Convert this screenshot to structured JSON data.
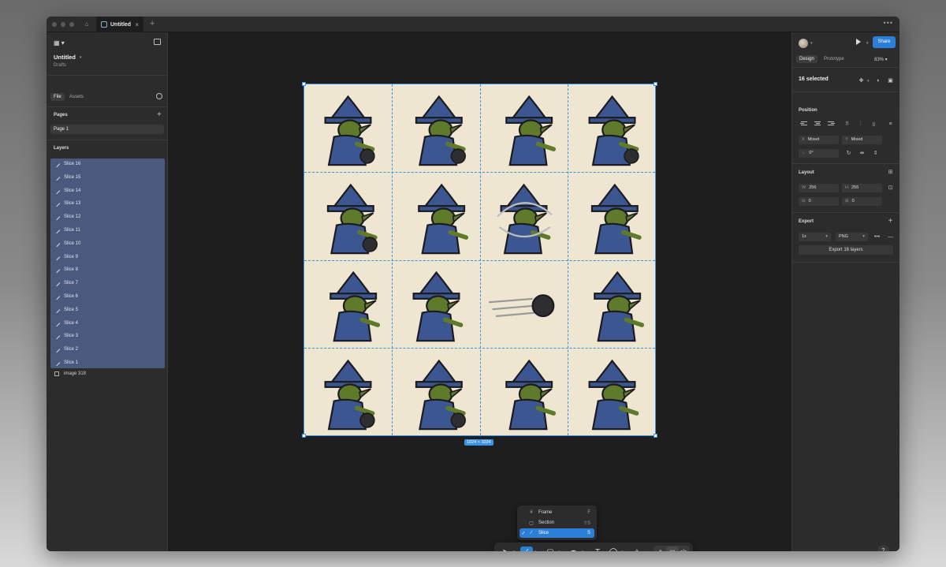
{
  "tabs": {
    "active_label": "Untitled",
    "close_glyph": "×",
    "new_glyph": "+",
    "more_glyph": "•••"
  },
  "left": {
    "file_title": "Untitled",
    "file_subtitle": "Drafts",
    "tab_file": "File",
    "tab_assets": "Assets",
    "pages_heading": "Pages",
    "add_glyph": "+",
    "pages": [
      {
        "label": "Page 1"
      }
    ],
    "layers_heading": "Layers",
    "layers": [
      {
        "label": "Slice 16"
      },
      {
        "label": "Slice 15"
      },
      {
        "label": "Slice 14"
      },
      {
        "label": "Slice 13"
      },
      {
        "label": "Slice 12"
      },
      {
        "label": "Slice 11"
      },
      {
        "label": "Slice 10"
      },
      {
        "label": "Slice 9"
      },
      {
        "label": "Slice 8"
      },
      {
        "label": "Slice 7"
      },
      {
        "label": "Slice 6"
      },
      {
        "label": "Slice 5"
      },
      {
        "label": "Slice 4"
      },
      {
        "label": "Slice 3"
      },
      {
        "label": "Slice 2"
      },
      {
        "label": "Slice 1"
      }
    ],
    "image_layer": "image 318"
  },
  "canvas": {
    "size_badge": "1024 × 1024",
    "colors": {
      "selection": "#3b93e6",
      "paper": "#efe6d2",
      "robe": "#3b5690",
      "skin": "#5f7a2a",
      "ink": "#1c1c20"
    }
  },
  "tool_menu": {
    "items": [
      {
        "label": "Frame",
        "shortcut": "F",
        "icon": "frame-icon",
        "glyph": "#",
        "check": ""
      },
      {
        "label": "Section",
        "shortcut": "⇧S",
        "icon": "section-icon",
        "glyph": "▢",
        "check": ""
      },
      {
        "label": "Slice",
        "shortcut": "S",
        "icon": "slice-icon",
        "glyph": "⁄",
        "check": "✓"
      }
    ]
  },
  "toolbar": {
    "text_glyph": "T"
  },
  "right": {
    "share_label": "Share",
    "tab_design": "Design",
    "tab_prototype": "Prototype",
    "zoom": "83%",
    "selected_text": "16 selected",
    "position_heading": "Position",
    "x_label": "X",
    "x_value": "Mixed",
    "y_label": "Y",
    "y_value": "Mixed",
    "rotation_value": "0°",
    "layout_heading": "Layout",
    "w_label": "W",
    "w_value": "256",
    "h_label": "H",
    "h_value": "256",
    "gap_h_value": "0",
    "gap_v_value": "0",
    "export_heading": "Export",
    "export_scale": "1x",
    "export_format": "PNG",
    "export_button": "Export 16 layers",
    "help": "?"
  }
}
